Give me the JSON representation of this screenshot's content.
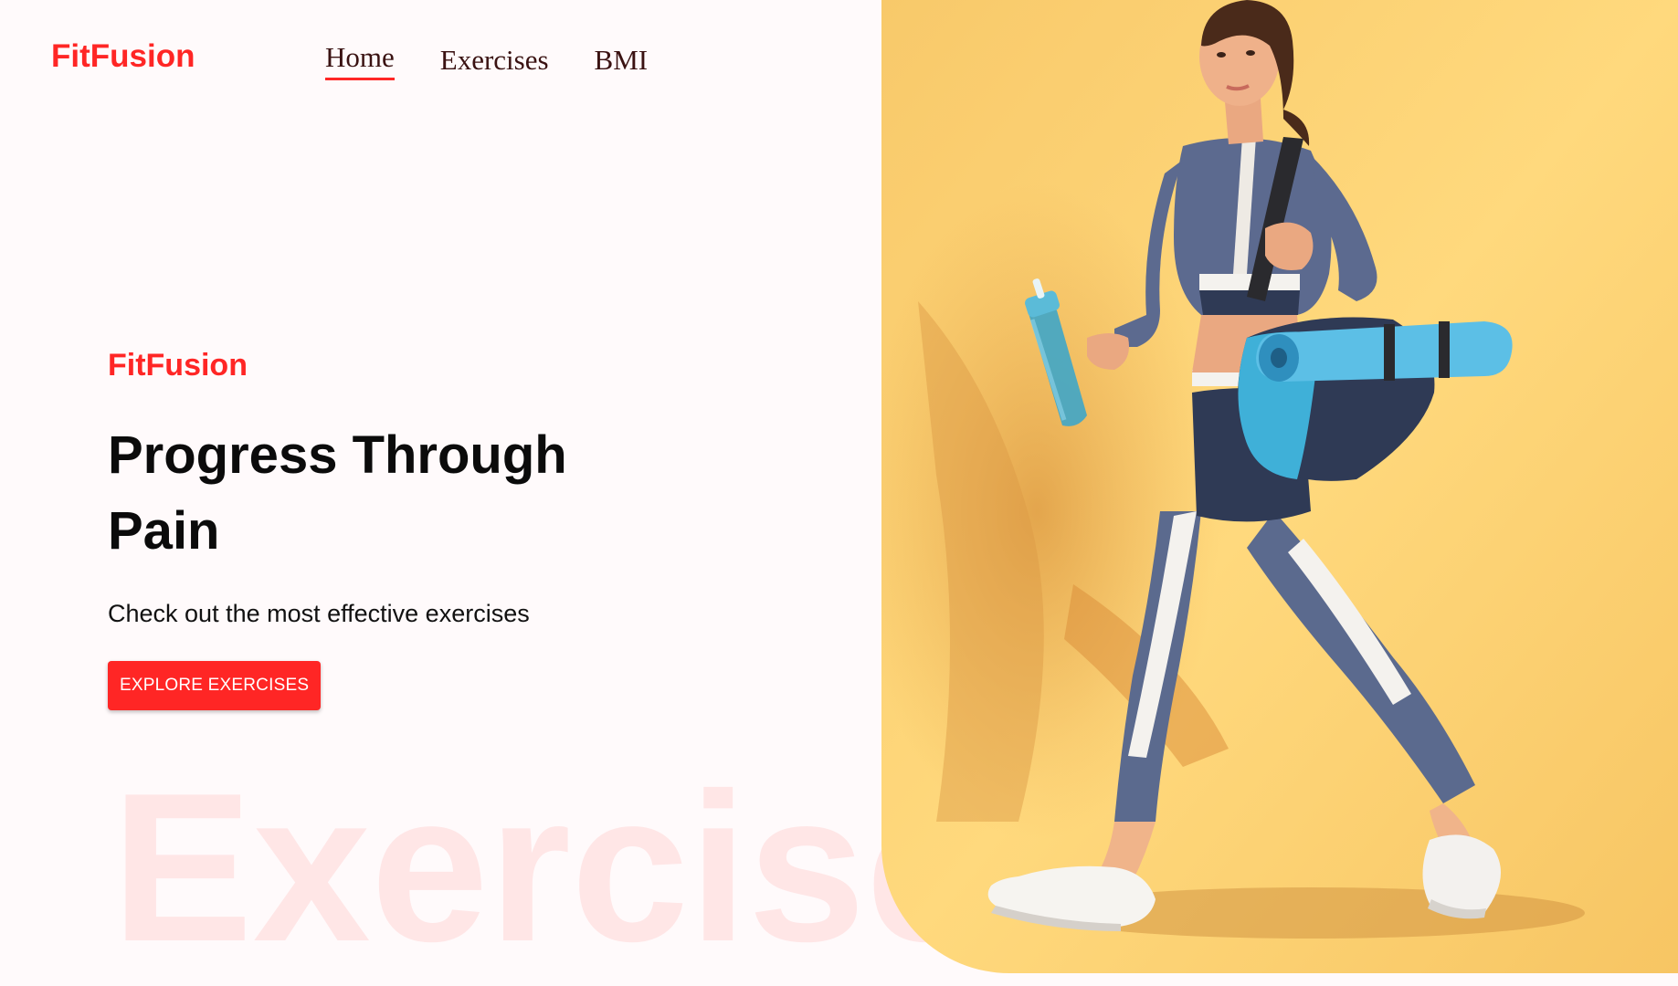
{
  "header": {
    "logo": "FitFusion",
    "nav": [
      {
        "label": "Home",
        "active": true
      },
      {
        "label": "Exercises",
        "active": false
      },
      {
        "label": "BMI",
        "active": false
      }
    ]
  },
  "hero": {
    "brand": "FitFusion",
    "title": "Progress Through Pain",
    "subtitle": "Check out the most effective exercises",
    "button_label": "EXPLORE EXERCISES"
  },
  "watermark": "Exercise",
  "colors": {
    "accent": "#ff2625",
    "page_bg": "#fffafb",
    "banner_bg": "#ffd66b",
    "text": "#0b0b0b"
  },
  "banner_image": {
    "name": "woman-walking-with-gym-bag-image"
  }
}
